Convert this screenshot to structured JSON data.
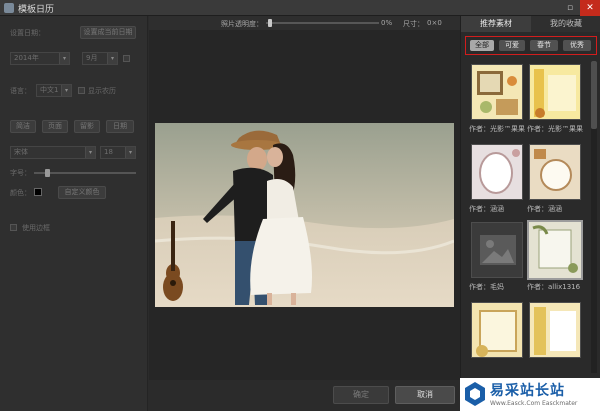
{
  "window": {
    "title": "模板日历",
    "maximize_glyph": "▫",
    "close_glyph": "✕"
  },
  "left_panel": {
    "set_date_label": "设置日期：",
    "set_current_date_button": "设置成当前日期",
    "year_value": "2014年",
    "month_value": "9月",
    "language_label": "语言：",
    "language_value": "中文1",
    "show_lunar_label": "显示农历",
    "style_buttons": [
      "简洁",
      "页面",
      "留影",
      "日期"
    ],
    "font_value": "宋体",
    "font_size_value": "18",
    "bold_label": "粗体：",
    "transparency_label": "字号：",
    "color_label": "颜色：",
    "custom_color_button": "自定义颜色",
    "apply_border_label": "使用边框"
  },
  "top_bar": {
    "opacity_label": "照片透明度：",
    "opacity_value": "0%",
    "size_label": "尺寸：",
    "size_value": "0×0"
  },
  "actions": {
    "confirm": "确定",
    "cancel": "取消"
  },
  "right_panel": {
    "tabs": [
      "推荐素材",
      "我的收藏"
    ],
    "categories": [
      "全部",
      "可爱",
      "春节",
      "优秀"
    ],
    "thumbs": [
      {
        "caption": "作者：光影™果果"
      },
      {
        "caption": "作者：光影™果果"
      },
      {
        "caption": "作者：涵涵"
      },
      {
        "caption": "作者：涵涵"
      },
      {
        "caption": "作者：毛妈"
      },
      {
        "caption": "作者：allix1316"
      },
      {
        "caption": ""
      },
      {
        "caption": ""
      }
    ]
  },
  "watermark": {
    "title": "易采站长站",
    "url": "Www.Easck.Com  Easckmater"
  },
  "colors": {
    "accent_red": "#d21d1d",
    "close_red": "#c42b1c",
    "watermark_blue": "#1a5ea8"
  }
}
